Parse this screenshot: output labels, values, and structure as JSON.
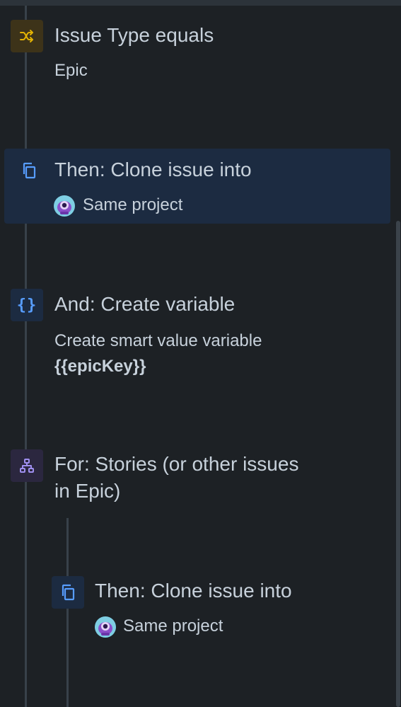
{
  "steps": {
    "condition": {
      "icon": "shuffle-icon",
      "title": "Issue Type equals",
      "detail": "Epic",
      "icon_bg": "#3d3319",
      "icon_color": "#e2b203"
    },
    "clone1": {
      "icon": "copy-icon",
      "title": "Then: Clone issue into",
      "project": "Same project",
      "icon_color": "#579dff"
    },
    "variable": {
      "icon": "braces-icon",
      "title": "And: Create variable",
      "detail_line1": "Create smart value variable",
      "detail_line2": "{{epicKey}}",
      "icon_bg": "#1c2b41",
      "icon_color": "#579dff"
    },
    "branch": {
      "icon": "hierarchy-icon",
      "title_line1": "For: Stories (or other issues",
      "title_line2": "in Epic)",
      "icon_bg": "#2b273f",
      "icon_color": "#9f8fef"
    },
    "clone2": {
      "icon": "copy-icon",
      "title": "Then: Clone issue into",
      "project": "Same project",
      "icon_bg": "#1c2b41",
      "icon_color": "#579dff"
    }
  },
  "colors": {
    "background": "#1d2125",
    "selected_bg": "#1c2b41",
    "rail": "#38414a",
    "text": "#c7d1db"
  }
}
